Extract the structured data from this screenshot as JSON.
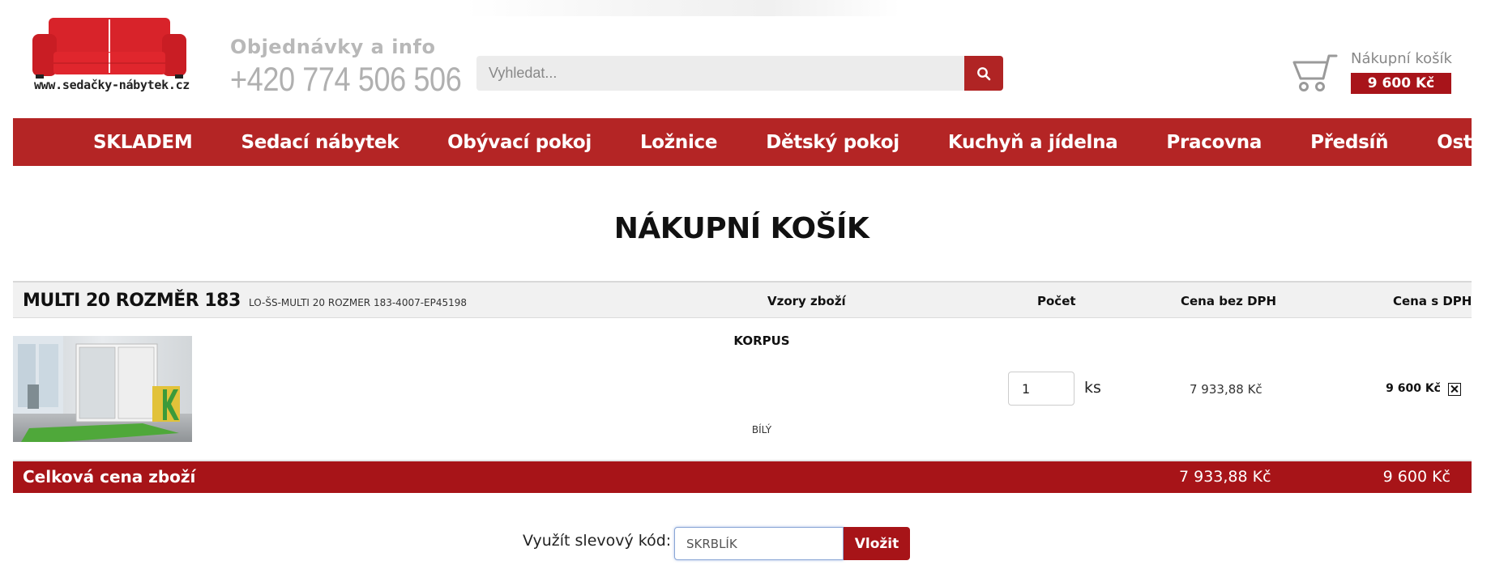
{
  "header": {
    "logo_text": "www.sedačky-nábytek.cz",
    "contact_label": "Objednávky a info",
    "phone": "+420 774 506 506",
    "search": {
      "placeholder": "Vyhledat...",
      "icon": "search-icon"
    },
    "cart": {
      "label": "Nákupní košík",
      "total": "9 600 Kč",
      "icon": "cart-icon"
    }
  },
  "nav": {
    "items": [
      {
        "label": "SKLADEM"
      },
      {
        "label": "Sedací nábytek"
      },
      {
        "label": "Obývací pokoj"
      },
      {
        "label": "Ložnice"
      },
      {
        "label": "Dětský pokoj"
      },
      {
        "label": "Kuchyň a jídelna"
      },
      {
        "label": "Pracovna"
      },
      {
        "label": "Předsíň"
      },
      {
        "label": "Ostatní"
      }
    ]
  },
  "page": {
    "title": "NÁKUPNÍ KOŠÍK"
  },
  "table": {
    "columns": {
      "variants": "Vzory zboží",
      "quantity": "Počet",
      "price_net": "Cena bez DPH",
      "price_gross": "Cena s DPH"
    },
    "product": {
      "name": "MULTI 20 ROZMĚR 183",
      "code": "LO-ŠS-MULTI 20 ROZMER 183-4007-EP45198",
      "variant_label": "KORPUS",
      "variant_value": "BÍLÝ",
      "quantity": "1",
      "unit": "ks",
      "price_net": "7 933,88 Kč",
      "price_gross": "9 600 Kč"
    },
    "totals": {
      "label": "Celková cena zboží",
      "net": "7 933,88 Kč",
      "gross": "9 600 Kč"
    }
  },
  "discount": {
    "label": "Využít slevový kód:",
    "value": "SKRBLÍK",
    "button": "Vložit"
  },
  "colors": {
    "brand_red": "#b42525",
    "dark_red": "#a71418"
  }
}
